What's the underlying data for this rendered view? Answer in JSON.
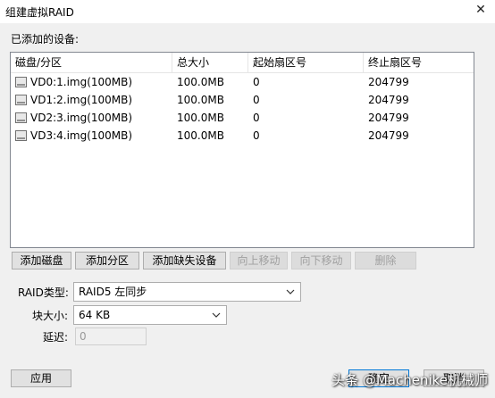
{
  "window": {
    "title": "组建虚拟RAID",
    "close": "✕"
  },
  "devices_label": "已添加的设备:",
  "table": {
    "headers": [
      "磁盘/分区",
      "总大小",
      "起始扇区号",
      "终止扇区号"
    ],
    "rows": [
      [
        "VD0:1.img(100MB)",
        "100.0MB",
        "0",
        "204799"
      ],
      [
        "VD1:2.img(100MB)",
        "100.0MB",
        "0",
        "204799"
      ],
      [
        "VD2:3.img(100MB)",
        "100.0MB",
        "0",
        "204799"
      ],
      [
        "VD3:4.img(100MB)",
        "100.0MB",
        "0",
        "204799"
      ]
    ]
  },
  "toolbar": {
    "add_disk": "添加磁盘",
    "add_partition": "添加分区",
    "add_missing": "添加缺失设备",
    "move_up": "向上移动",
    "move_down": "向下移动",
    "delete": "删除"
  },
  "form": {
    "raid_type_label": "RAID类型:",
    "raid_type_value": "RAID5 左同步",
    "block_size_label": "块大小:",
    "block_size_value": "64 KB",
    "delay_label": "延迟:",
    "delay_value": "0"
  },
  "footer": {
    "apply": "应用",
    "ok": "确定",
    "cancel": "取消"
  },
  "watermark": "头条 @Machenike机械师"
}
